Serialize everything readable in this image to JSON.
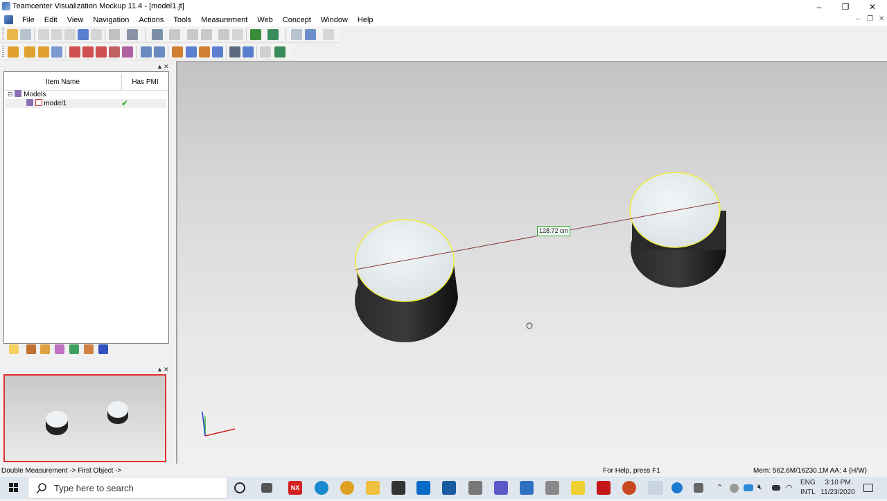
{
  "window": {
    "title": "Teamcenter Visualization Mockup 11.4 - [model1.jt]",
    "minimize": "–",
    "restore": "❐",
    "close": "✕",
    "mdi_min": "–",
    "mdi_restore": "❐",
    "mdi_close": "✕"
  },
  "menu": [
    "File",
    "Edit",
    "View",
    "Navigation",
    "Actions",
    "Tools",
    "Measurement",
    "Web",
    "Concept",
    "Window",
    "Help"
  ],
  "tree": {
    "col_item_name": "Item Name",
    "col_has_pmi": "Has PMI",
    "root_label": "Models",
    "child_label": "model1",
    "child_has_pmi": "✔"
  },
  "panel_buttons": {
    "pin": "▲",
    "close": "✕"
  },
  "viewport": {
    "measurement_label": "128.72 cm"
  },
  "status": {
    "left": "Double Measurement -> First Object ->",
    "help": "For Help, press F1",
    "mem": "Mem: 562.6M/16230.1M  AA: 4 (H/W)"
  },
  "taskbar": {
    "search_placeholder": "Type here to search",
    "lang_top": "ENG",
    "lang_bottom": "INTL",
    "time": "3:10 PM",
    "date": "11/23/2020",
    "nx_label": "NX"
  },
  "colors": {
    "accent_red": "#e23030",
    "highlight_yellow": "#f2ef3a",
    "pmi_green": "#22aa22"
  }
}
